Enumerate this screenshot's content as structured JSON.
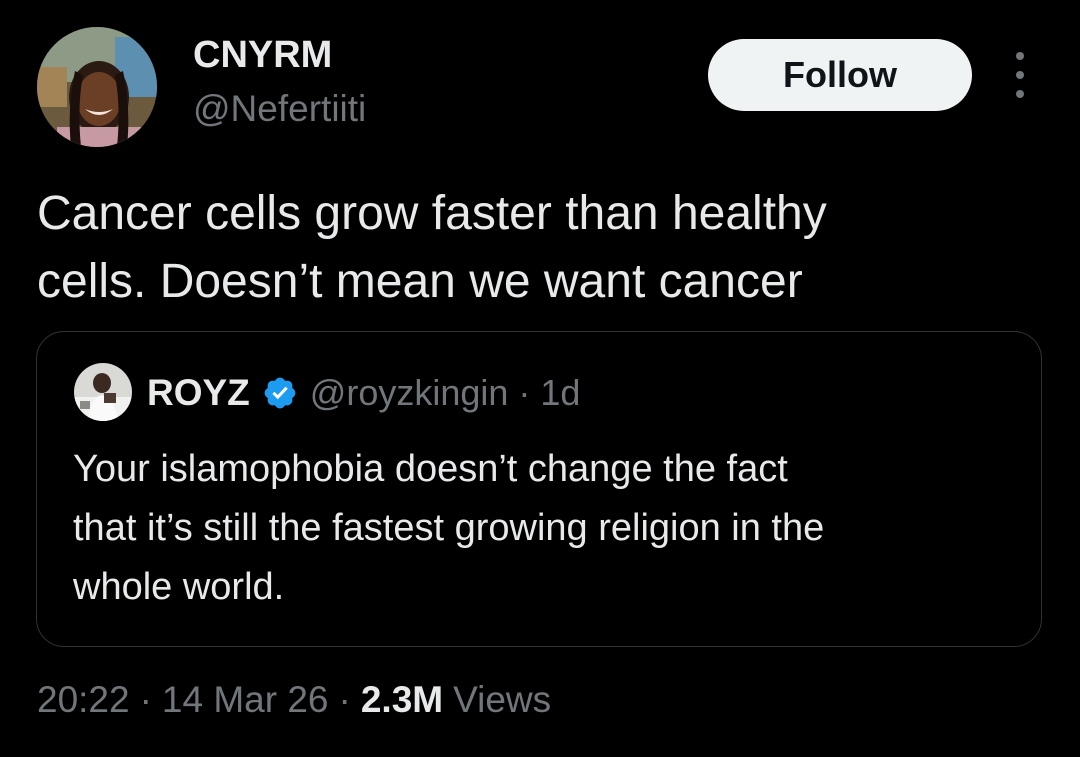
{
  "tweet": {
    "author": {
      "name": "CNYRM",
      "handle": "@Nefertiiti",
      "avatar": "profile-photo"
    },
    "follow_label": "Follow",
    "more_icon": "more-vertical-icon",
    "text_lines": [
      "Cancer cells grow faster than healthy",
      "cells. Doesn’t mean we want cancer"
    ],
    "quoted": {
      "author_name": "ROYZ",
      "verified": true,
      "verified_icon": "verified-badge-icon",
      "handle": "@royzkingin",
      "separator": "·",
      "time": "1d",
      "avatar": "profile-photo",
      "text_lines": [
        "Your islamophobia doesn’t change the fact",
        "that it’s still the fastest growing religion in the",
        "whole world."
      ]
    },
    "meta": {
      "time": "20:22",
      "date": "14 Mar 26",
      "separator": "·",
      "views_count": "2.3M",
      "views_label": "Views"
    }
  },
  "colors": {
    "background": "#000000",
    "primary_text": "#e7e9ea",
    "secondary_text": "#71767b",
    "border": "#2f3336",
    "follow_bg": "#eff3f4",
    "verified_blue": "#1d9bf0"
  }
}
